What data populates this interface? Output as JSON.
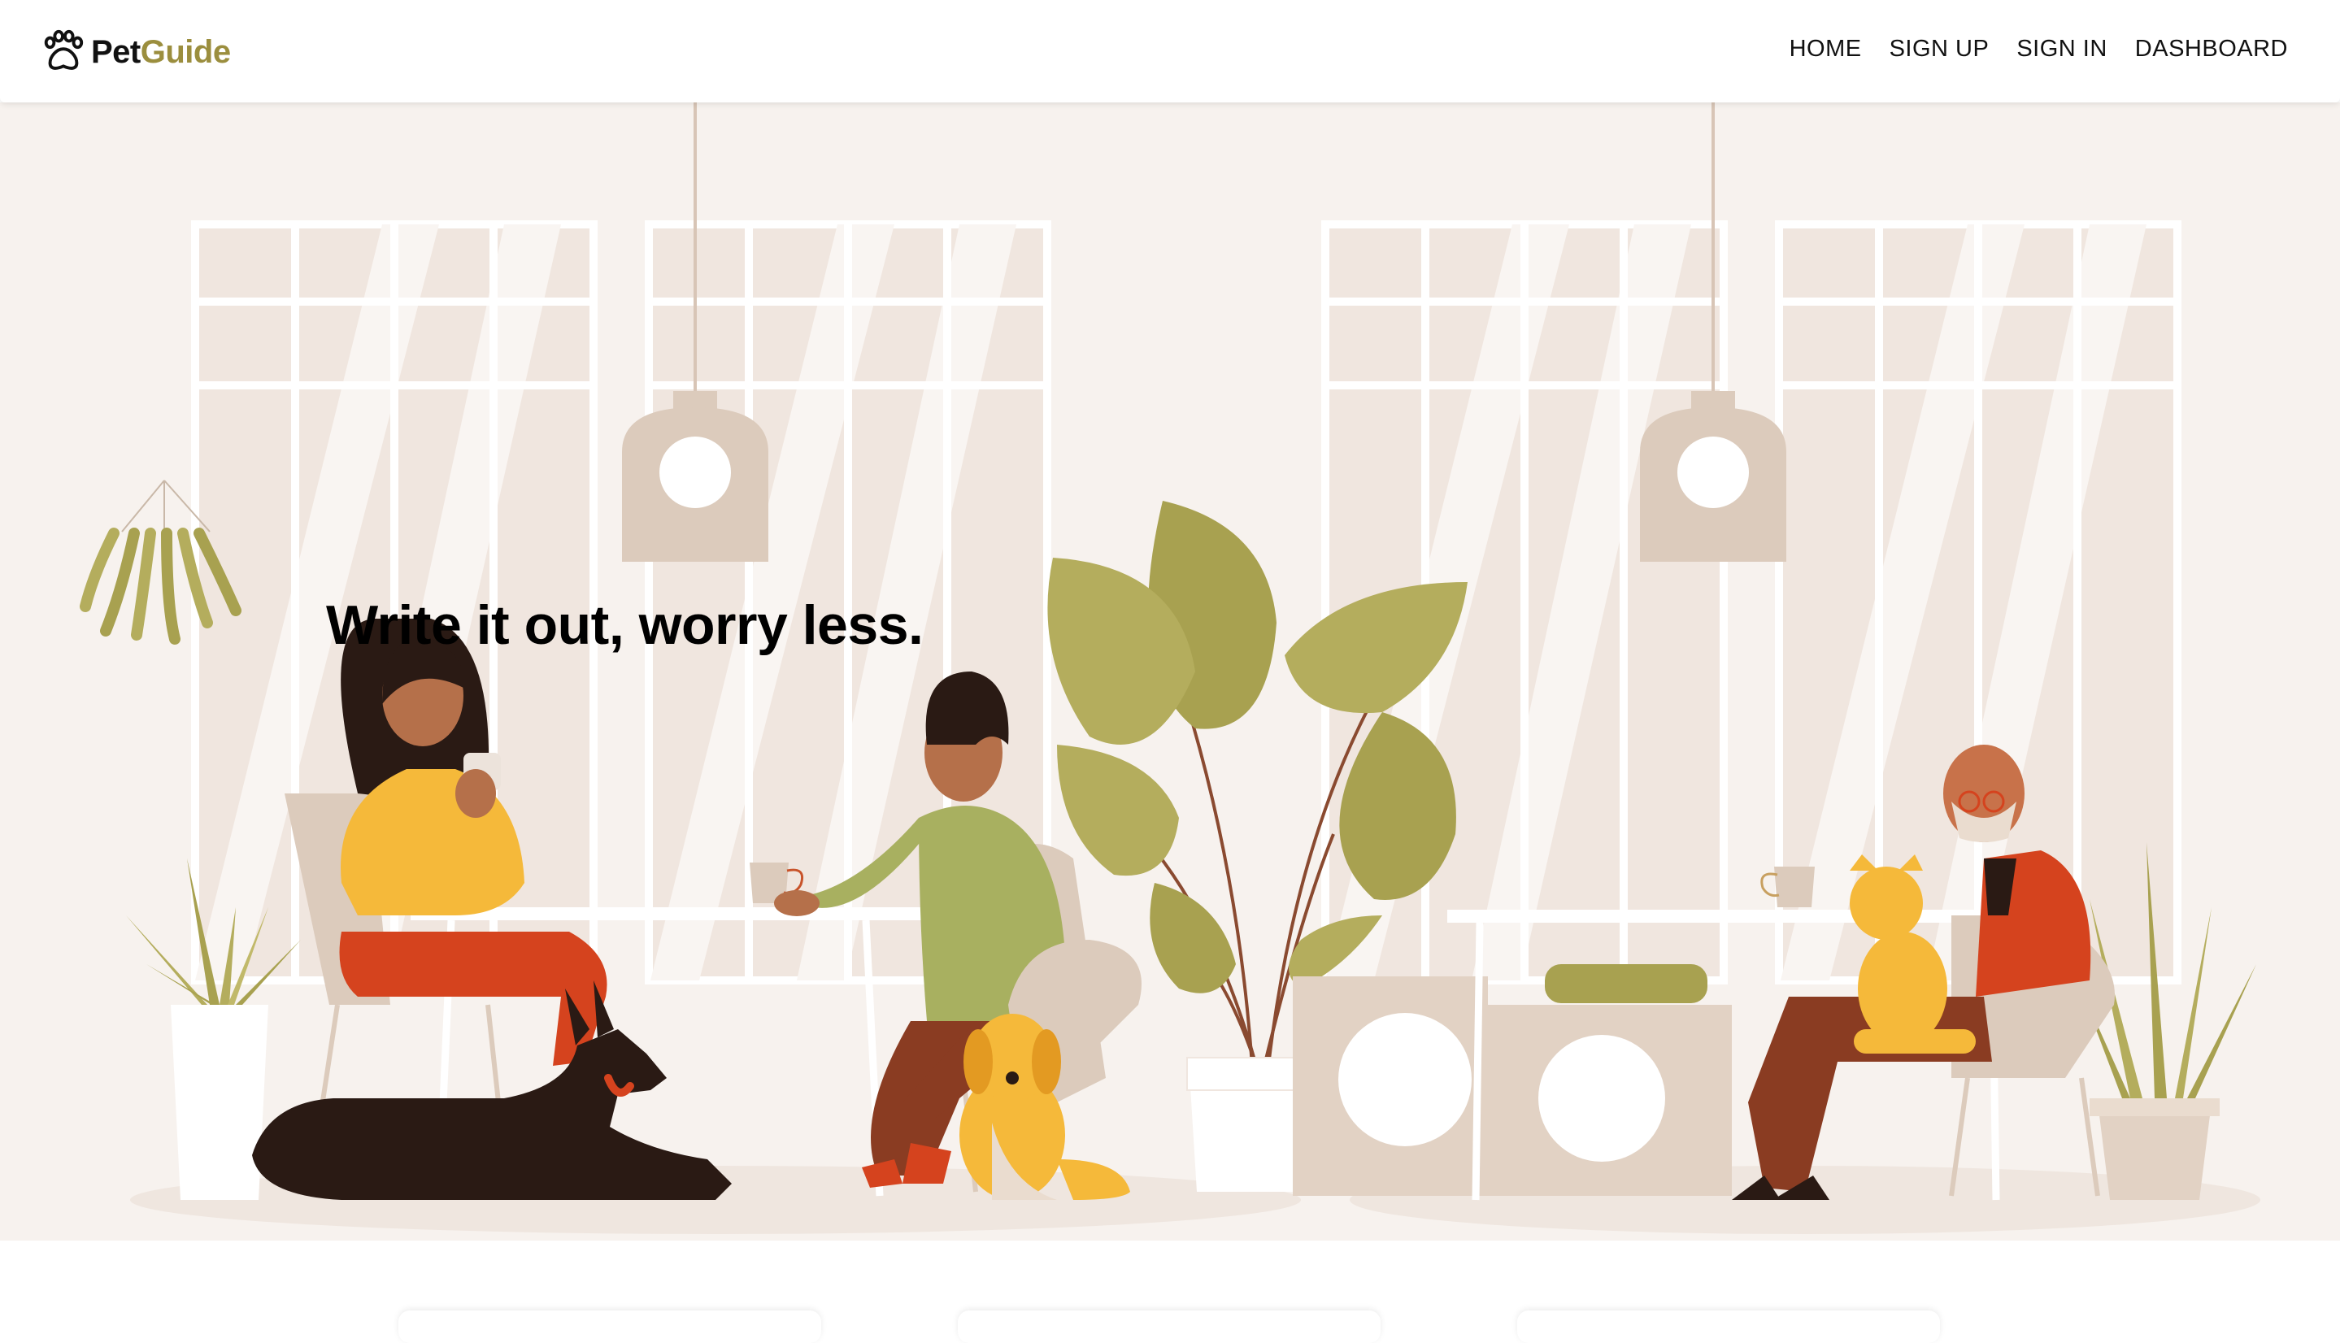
{
  "navbar": {
    "brand": {
      "part1": "Pet",
      "part2": "Guide",
      "icon": "paw-icon",
      "accent_color": "#9b8e3e"
    },
    "links": [
      {
        "label": "HOME"
      },
      {
        "label": "SIGN UP"
      },
      {
        "label": "SIGN IN"
      },
      {
        "label": "DASHBOARD"
      }
    ]
  },
  "hero": {
    "headline": "Write it out, worry less.",
    "background_color": "#f7f2ee",
    "illustration": "cafe-scene-with-people-and-pets"
  },
  "cards": {
    "count": 3
  }
}
